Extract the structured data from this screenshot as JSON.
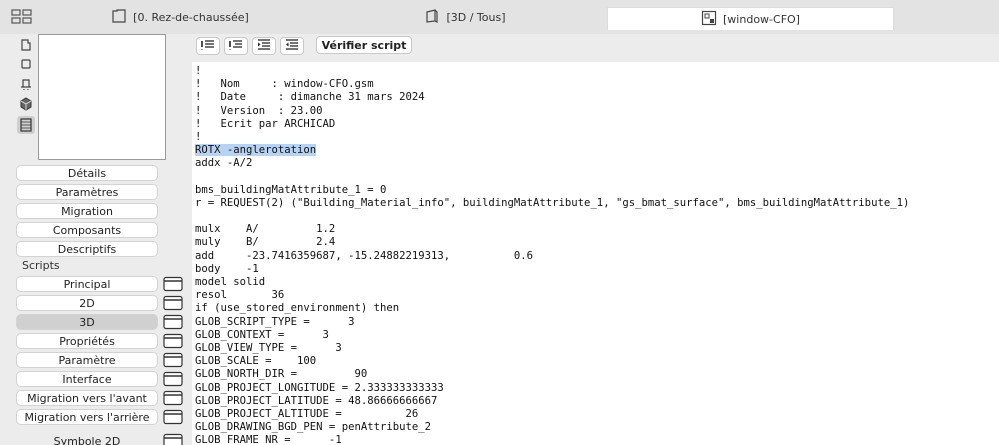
{
  "tabs": [
    {
      "label": "[0. Rez-de-chaussée]",
      "icon": "floor-plan-icon"
    },
    {
      "label": "[3D / Tous]",
      "icon": "3d-view-icon"
    },
    {
      "label": "[window-CFO]",
      "icon": "gdl-object-icon"
    }
  ],
  "sidebar": {
    "section_buttons": [
      "Détails",
      "Paramètres",
      "Migration",
      "Composants",
      "Descriptifs"
    ],
    "scripts_label": "Scripts",
    "script_buttons": [
      "Principal",
      "2D",
      "3D",
      "Propriétés",
      "Paramètre",
      "Interface",
      "Migration vers l'avant",
      "Migration vers l'arrière",
      "Symbole 2D"
    ],
    "active_script": "3D"
  },
  "toolbar": {
    "verify_label": "Vérifier script"
  },
  "code": {
    "selected_line_index": 6,
    "lines": [
      "!",
      "!   Nom     : window-CFO.gsm",
      "!   Date     : dimanche 31 mars 2024",
      "!   Version  : 23.00",
      "!   Ecrit par ARCHICAD",
      "!",
      "ROTX -anglerotation",
      "addx -A/2",
      "",
      "bms_buildingMatAttribute_1 = 0",
      "r = REQUEST(2) (\"Building_Material_info\", buildingMatAttribute_1, \"gs_bmat_surface\", bms_buildingMatAttribute_1)",
      "",
      "mulx    A/         1.2",
      "muly    B/         2.4",
      "add     -23.7416359687, -15.24882219313,          0.6",
      "body    -1",
      "model solid",
      "resol       36",
      "if (use_stored_environment) then",
      "GLOB_SCRIPT_TYPE =      3",
      "GLOB_CONTEXT =      3",
      "GLOB_VIEW_TYPE =      3",
      "GLOB_SCALE =    100",
      "GLOB_NORTH_DIR =         90",
      "GLOB_PROJECT_LONGITUDE = 2.333333333333",
      "GLOB_PROJECT_LATITUDE = 48.86666666667",
      "GLOB_PROJECT_ALTITUDE =          26",
      "GLOB_DRAWING_BGD_PEN = penAttribute_2",
      "GLOB_FRAME_NR =      -1"
    ]
  }
}
